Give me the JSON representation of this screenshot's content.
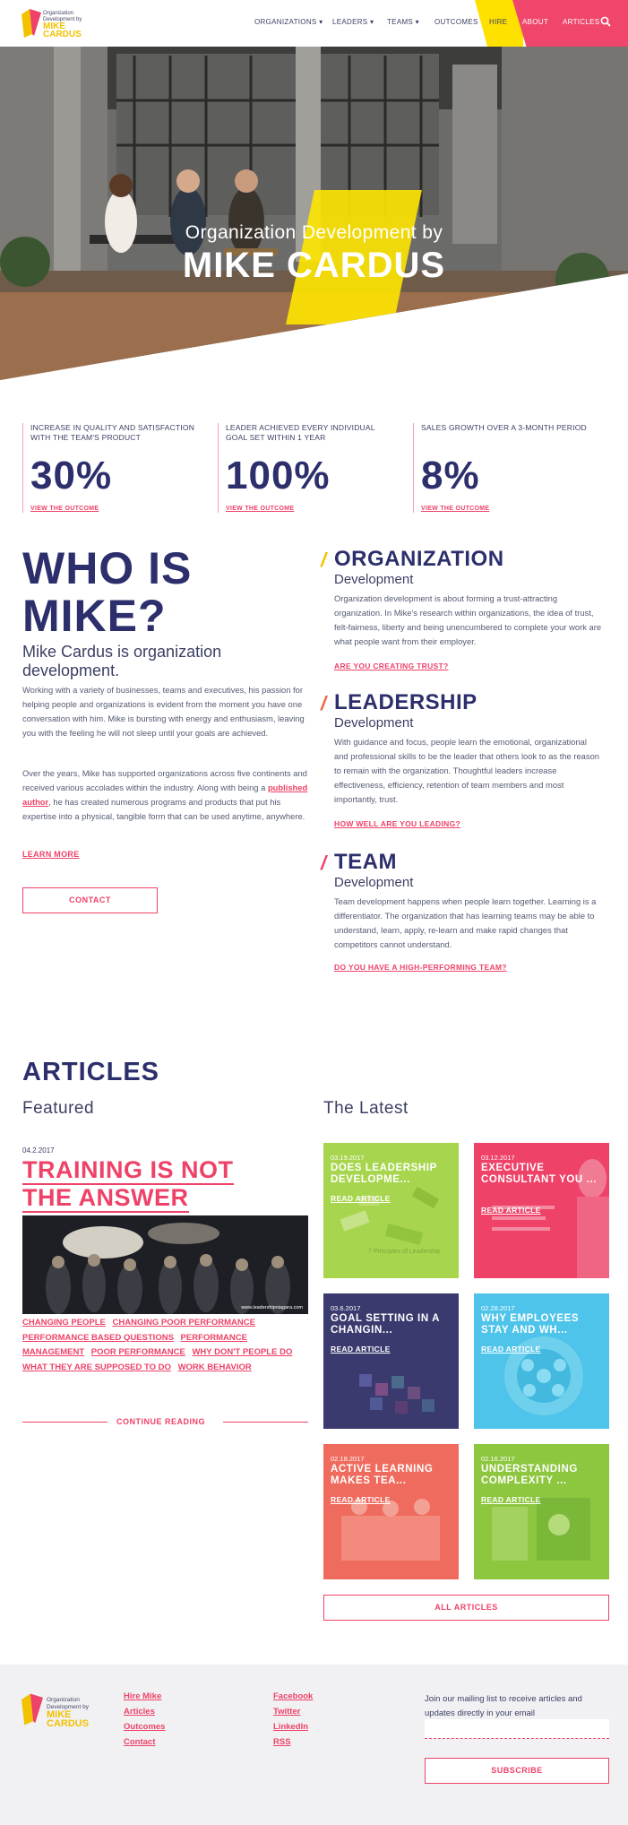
{
  "nav": {
    "logo_line1": "Organization Development by",
    "logo_line2": "MIKE CARDUS",
    "items": [
      {
        "label": "ORGANIZATIONS",
        "caret": "▾"
      },
      {
        "label": "LEADERS",
        "caret": "▾"
      },
      {
        "label": "TEAMS",
        "caret": "▾"
      },
      {
        "label": "OUTCOMES",
        "caret": ""
      },
      {
        "label": "HIRE",
        "caret": ""
      },
      {
        "label": "ABOUT",
        "caret": ""
      },
      {
        "label": "ARTICLES",
        "caret": ""
      }
    ],
    "search_icon": "search-icon"
  },
  "hero": {
    "subtitle": "Organization Development by",
    "title": "MIKE CARDUS"
  },
  "stats": [
    {
      "label": "INCREASE IN QUALITY AND SATISFACTION WITH THE TEAM'S PRODUCT",
      "value": "30%",
      "link": "VIEW THE OUTCOME"
    },
    {
      "label": "LEADER ACHIEVED EVERY INDIVIDUAL GOAL SET WITHIN 1 YEAR",
      "value": "100%",
      "link": "VIEW THE OUTCOME"
    },
    {
      "label": "SALES GROWTH OVER A 3-MONTH PERIOD",
      "value": "8%",
      "link": "VIEW THE OUTCOME"
    }
  ],
  "who": {
    "title_line1": "WHO IS",
    "title_line2": "MIKE?",
    "subtitle": "Mike Cardus is organization development.",
    "p1": "Working with a variety of businesses, teams and executives, his passion for helping people and organizations is evident from the moment you have one conversation with him. Mike is bursting with energy and enthusiasm, leaving you with the feeling he will not sleep until your goals are achieved.",
    "p2_before": "Over the years, Mike has supported organizations across five continents and received various accolades within the industry. Along with being a ",
    "p2_link": "published author",
    "p2_after": ", he has created numerous programs and products that put his expertise into a physical, tangible form that can be used anytime, anywhere.",
    "learn_more": "LEARN MORE",
    "contact": "CONTACT"
  },
  "pillars": [
    {
      "title": "ORGANIZATION",
      "subtitle": "Development",
      "text": "Organization development is about forming a trust-attracting organization. In Mike's research within organizations, the idea of trust, felt-fairness, liberty and being unencumbered to complete your work are what people want from their employer.",
      "link": "ARE YOU CREATING TRUST?",
      "slash_color": "#f2c200"
    },
    {
      "title": "LEADERSHIP",
      "subtitle": "Development",
      "text": "With guidance and focus, people learn the emotional, organizational and professional skills to be the leader that others look to as the reason to remain with the organization. Thoughtful leaders increase effectiveness, efficiency, retention of team members and most importantly, trust.",
      "link": "HOW WELL ARE YOU LEADING?",
      "slash_color": "#f0653f"
    },
    {
      "title": "TEAM",
      "subtitle": "Development",
      "text": "Team development happens when people learn together. Learning is a differentiator. The organization that has learning teams may be able to understand, learn, apply, re-learn and make rapid changes that competitors cannot understand.",
      "link": "DO YOU HAVE A HIGH-PERFORMING TEAM?",
      "slash_color": "#ee4268"
    }
  ],
  "articles": {
    "heading": "ARTICLES",
    "featured_heading": "Featured",
    "latest_heading": "The Latest",
    "featured": {
      "date": "04.2.2017",
      "title_line1": "TRAINING IS NOT",
      "title_line2": "THE ANSWER",
      "image_caption": "www.leadershipniagara.com",
      "tags": [
        "CHANGING PEOPLE",
        "CHANGING POOR PERFORMANCE",
        "PERFORMANCE BASED QUESTIONS",
        "PERFORMANCE MANAGEMENT",
        "POOR PERFORMANCE",
        "WHY DON'T PEOPLE DO WHAT THEY ARE SUPPOSED TO DO",
        "WORK BEHAVIOR"
      ],
      "continue": "CONTINUE READING"
    },
    "cards": [
      {
        "date": "03.19.2017",
        "title": "DOES LEADERSHIP DEVELOPME...",
        "read": "READ ARTICLE",
        "color": "#a7d64e",
        "overlay_text": "7 Principles of Leadership"
      },
      {
        "date": "03.12.2017",
        "title": "EXECUTIVE CONSULTANT YOU ...",
        "read": "READ ARTICLE",
        "color": "#ee4268",
        "overlay_text": ""
      },
      {
        "date": "03.6.2017",
        "title": "GOAL SETTING IN A CHANGIN...",
        "read": "READ ARTICLE",
        "color": "#3a3a6e",
        "overlay_text": ""
      },
      {
        "date": "02.28.2017",
        "title": "WHY EMPLOYEES STAY AND WH...",
        "read": "READ ARTICLE",
        "color": "#4fc4ea",
        "overlay_text": ""
      },
      {
        "date": "02.18.2017",
        "title": "ACTIVE LEARNING MAKES TEA...",
        "read": "READ ARTICLE",
        "color": "#ef6b5e",
        "overlay_text": ""
      },
      {
        "date": "02.16.2017",
        "title": "UNDERSTANDING COMPLEXITY ...",
        "read": "READ ARTICLE",
        "color": "#8dc63f",
        "overlay_text": ""
      }
    ],
    "all_articles": "ALL ARTICLES"
  },
  "footer": {
    "links_col1": [
      "Hire Mike",
      "Articles",
      "Outcomes",
      "Contact"
    ],
    "links_col2": [
      "Facebook",
      "Twitter",
      "LinkedIn",
      "RSS"
    ],
    "mailing_text": "Join our mailing list to receive articles and updates directly in your email",
    "email_placeholder": "",
    "subscribe": "SUBSCRIBE"
  },
  "colors": {
    "brand_pink": "#ee4268",
    "brand_yellow": "#ffe100",
    "brand_navy": "#2c2f6b"
  }
}
